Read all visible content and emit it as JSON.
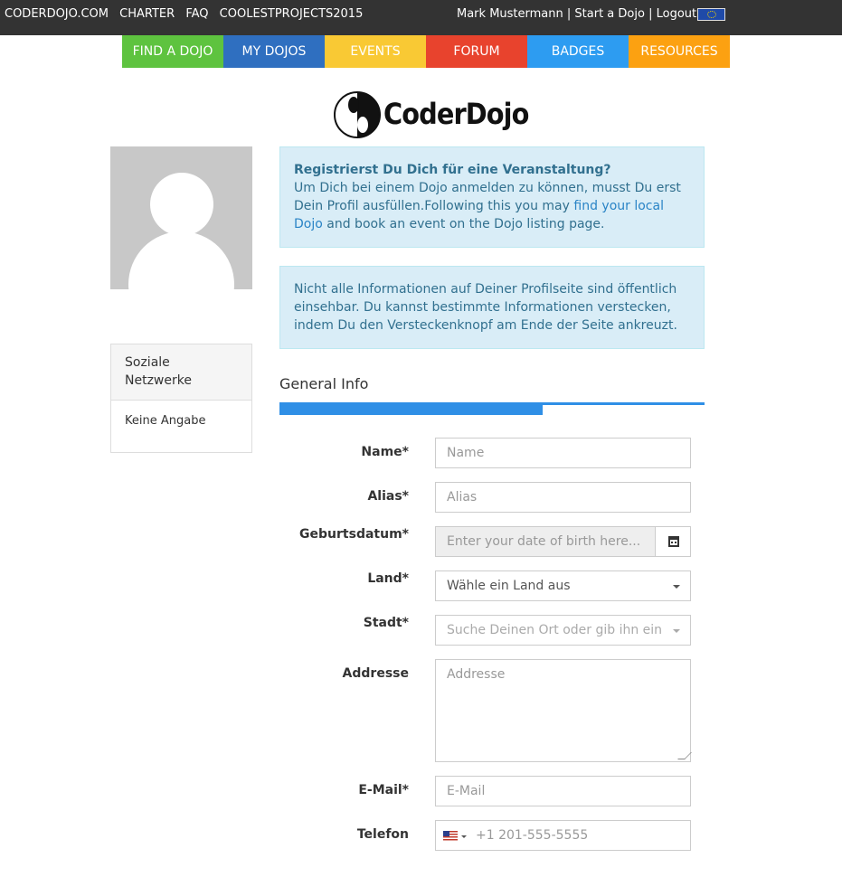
{
  "topbar": {
    "links": [
      "CODERDOJO.COM",
      "CHARTER",
      "FAQ",
      "COOLESTPROJECTS2015"
    ],
    "user_name": "Mark Mustermann",
    "sep1": "|",
    "start_dojo": "Start a Dojo",
    "sep2": "|",
    "logout": "Logout",
    "language_flag": "eu-flag-icon"
  },
  "nav": [
    {
      "label": "FIND A DOJO",
      "color": "#5ec33f"
    },
    {
      "label": "MY DOJOS",
      "color": "#2f6fc0"
    },
    {
      "label": "EVENTS",
      "color": "#f9c934"
    },
    {
      "label": "FORUM",
      "color": "#e8432d"
    },
    {
      "label": "BADGES",
      "color": "#2d9cf1"
    },
    {
      "label": "RESOURCES",
      "color": "#fca111"
    }
  ],
  "logo": {
    "text": "CoderDojo"
  },
  "social": {
    "heading": "Soziale Netzwerke",
    "content": "Keine Angabe"
  },
  "alert1": {
    "title": "Registrierst Du Dich für eine Veranstaltung?",
    "text_before": "Um Dich bei einem Dojo anmelden zu können, musst Du erst Dein Profil ausfüllen.Following this you may ",
    "link": "find your local Dojo",
    "text_after": " and book an event on the Dojo listing page."
  },
  "alert2": {
    "text": "Nicht alle Informationen auf Deiner Profilseite sind öffentlich einsehbar. Du kannst bestimmte Informationen verstecken, indem Du den Versteckenknopf am Ende der Seite ankreuzt."
  },
  "general_info": {
    "title": "General Info",
    "progress_fraction": 0.62
  },
  "form": {
    "name_label": "Name*",
    "name_placeholder": "Name",
    "alias_label": "Alias*",
    "alias_placeholder": "Alias",
    "dob_label": "Geburtsdatum*",
    "dob_placeholder": "Enter your date of birth here...",
    "country_label": "Land*",
    "country_value": "Wähle ein Land aus",
    "city_label": "Stadt*",
    "city_value": "Suche Deinen Ort oder gib ihn ein",
    "address_label": "Addresse",
    "address_placeholder": "Addresse",
    "email_label": "E-Mail*",
    "email_placeholder": "E-Mail",
    "phone_label": "Telefon",
    "phone_placeholder": "+1 201-555-5555"
  }
}
